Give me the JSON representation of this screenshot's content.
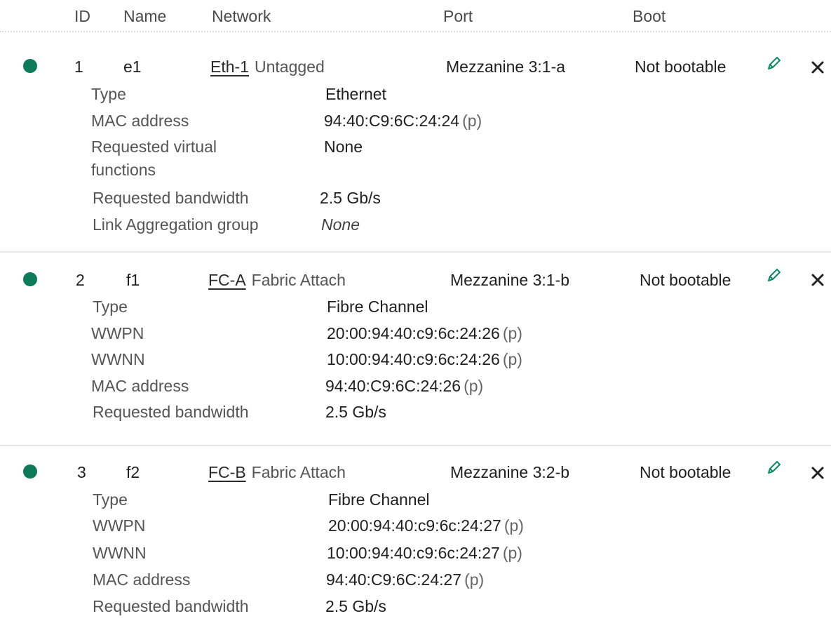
{
  "columns": {
    "id": "ID",
    "name": "Name",
    "network": "Network",
    "port": "Port",
    "boot": "Boot"
  },
  "status_color": "#0d7a5a",
  "connections": [
    {
      "id": "1",
      "name": "e1",
      "network": "Eth-1",
      "network_mode": "Untagged",
      "port": "Mezzanine 3:1-a",
      "boot": "Not bootable",
      "edit_icon": "pencil-icon",
      "remove_icon": "close-icon",
      "details": [
        {
          "label": "Type",
          "value": "Ethernet",
          "suffix": ""
        },
        {
          "label": "MAC address",
          "value": "94:40:C9:6C:24:24",
          "suffix": "(p)"
        },
        {
          "label": "Requested virtual functions",
          "value": "None",
          "suffix": ""
        },
        {
          "label": "Requested bandwidth",
          "value": "2.5 Gb/s",
          "suffix": ""
        },
        {
          "label": "Link Aggregation group",
          "value": "None",
          "suffix": ""
        }
      ]
    },
    {
      "id": "2",
      "name": "f1",
      "network": "FC-A",
      "network_mode": "Fabric Attach",
      "port": "Mezzanine 3:1-b",
      "boot": "Not bootable",
      "edit_icon": "pencil-icon",
      "remove_icon": "close-icon",
      "details": [
        {
          "label": "Type",
          "value": "Fibre Channel",
          "suffix": ""
        },
        {
          "label": "WWPN",
          "value": "20:00:94:40:c9:6c:24:26",
          "suffix": "(p)"
        },
        {
          "label": "WWNN",
          "value": "10:00:94:40:c9:6c:24:26",
          "suffix": "(p)"
        },
        {
          "label": "MAC address",
          "value": "94:40:C9:6C:24:26",
          "suffix": "(p)"
        },
        {
          "label": "Requested bandwidth",
          "value": "2.5 Gb/s",
          "suffix": ""
        }
      ]
    },
    {
      "id": "3",
      "name": "f2",
      "network": "FC-B",
      "network_mode": "Fabric Attach",
      "port": "Mezzanine 3:2-b",
      "boot": "Not bootable",
      "edit_icon": "pencil-icon",
      "remove_icon": "close-icon",
      "details": [
        {
          "label": "Type",
          "value": "Fibre Channel",
          "suffix": ""
        },
        {
          "label": "WWPN",
          "value": "20:00:94:40:c9:6c:24:27",
          "suffix": "(p)"
        },
        {
          "label": "WWNN",
          "value": "10:00:94:40:c9:6c:24:27",
          "suffix": "(p)"
        },
        {
          "label": "MAC address",
          "value": "94:40:C9:6C:24:27",
          "suffix": "(p)"
        },
        {
          "label": "Requested bandwidth",
          "value": "2.5 Gb/s",
          "suffix": ""
        }
      ]
    }
  ]
}
